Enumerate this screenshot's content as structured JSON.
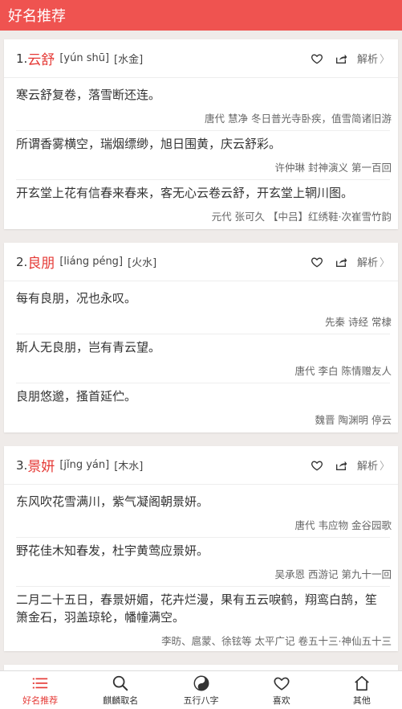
{
  "header": {
    "title": "好名推荐"
  },
  "cards": [
    {
      "index": "1.",
      "name": "云舒",
      "pinyin": "[yún shū]",
      "wuxing": "[水金]",
      "detail_label": "解析",
      "quotes": [
        {
          "text": "寒云舒复卷，落雪断还连。",
          "source": "唐代 慧净 冬日普光寺卧疾，值雪简诸旧游"
        },
        {
          "text": "所谓香雾横空，瑞烟缥缈，旭日围黄，庆云舒彩。",
          "source": "许仲琳 封神演义 第一百回"
        },
        {
          "text": "开玄堂上花有信春来春来，客无心云卷云舒，开玄堂上辋川图。",
          "source": "元代 张可久 【中吕】红绣鞋·次崔雪竹韵"
        }
      ]
    },
    {
      "index": "2.",
      "name": "良朋",
      "pinyin": "[liáng péng]",
      "wuxing": "[火水]",
      "detail_label": "解析",
      "quotes": [
        {
          "text": "每有良朋，况也永叹。",
          "source": "先秦 诗经 常棣"
        },
        {
          "text": "斯人无良朋，岂有青云望。",
          "source": "唐代 李白 陈情赠友人"
        },
        {
          "text": "良朋悠邈，搔首延伫。",
          "source": "魏晋 陶渊明 停云"
        }
      ]
    },
    {
      "index": "3.",
      "name": "景妍",
      "pinyin": "[jǐng yán]",
      "wuxing": "[木水]",
      "detail_label": "解析",
      "quotes": [
        {
          "text": "东风吹花雪满川，紫气凝阁朝景妍。",
          "source": "唐代 韦应物 金谷园歌"
        },
        {
          "text": "野花佳木知春发，杜宇黄莺应景妍。",
          "source": "吴承恩 西游记 第九十一回"
        },
        {
          "text": "二月二十五日，春景妍媚，花卉烂漫，果有五云唳鹤，翔鸾白鹄，笙箫金石，羽盖琼轮，幡幢满空。",
          "source": "李昉、扈蒙、徐铉等 太平广记 卷五十三·神仙五十三"
        }
      ]
    }
  ],
  "tabs": [
    {
      "label": "好名推荐",
      "icon": "list-icon",
      "active": true
    },
    {
      "label": "麒麟取名",
      "icon": "search-icon",
      "active": false
    },
    {
      "label": "五行八字",
      "icon": "yin-yang-icon",
      "active": false
    },
    {
      "label": "喜欢",
      "icon": "heart-icon",
      "active": false
    },
    {
      "label": "其他",
      "icon": "home-icon",
      "active": false
    }
  ],
  "colors": {
    "accent": "#ef5350",
    "name_red": "#e53935",
    "background": "#efebe9"
  }
}
